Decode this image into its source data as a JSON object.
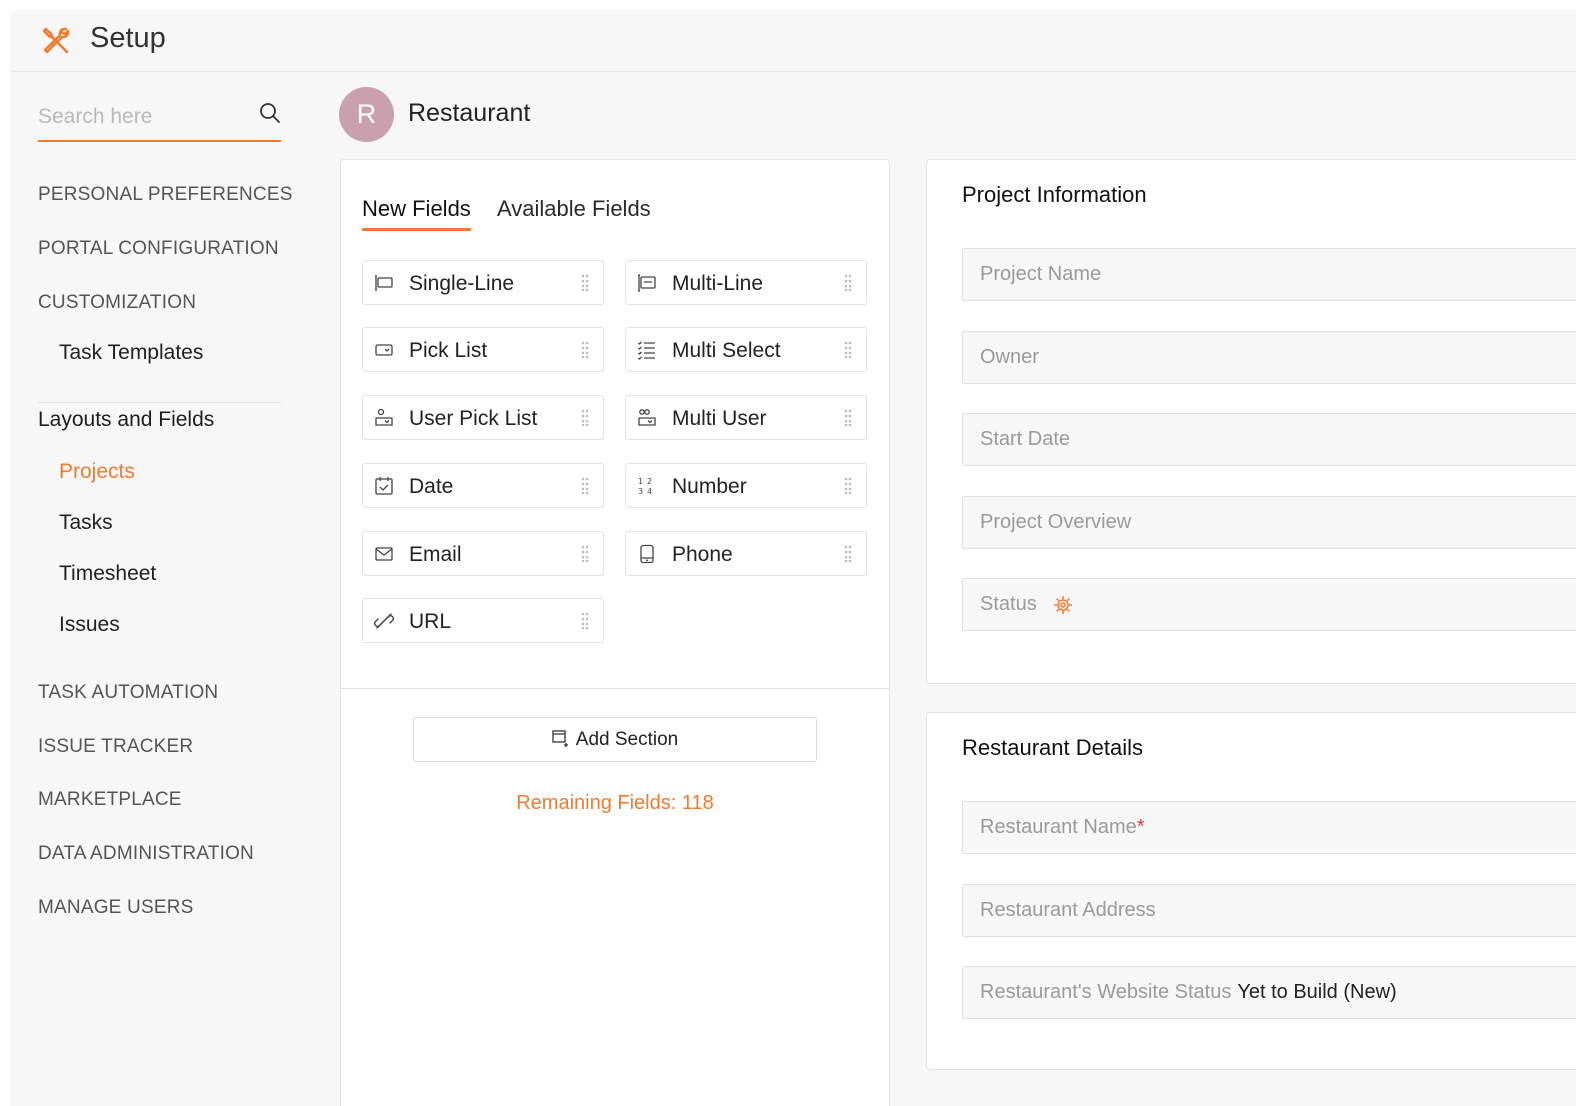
{
  "header": {
    "title": "Setup"
  },
  "sidebar": {
    "search_placeholder": "Search here",
    "sections": {
      "personal_preferences": "PERSONAL PREFERENCES",
      "portal_configuration": "PORTAL CONFIGURATION",
      "customization": "CUSTOMIZATION",
      "task_automation": "TASK AUTOMATION",
      "issue_tracker": "ISSUE TRACKER",
      "marketplace": "MARKETPLACE",
      "data_administration": "DATA ADMINISTRATION",
      "manage_users": "MANAGE USERS"
    },
    "task_templates": "Task Templates",
    "layouts_group": "Layouts and Fields",
    "layout_items": [
      "Projects",
      "Tasks",
      "Timesheet",
      "Issues"
    ],
    "active_item": "Projects"
  },
  "layout": {
    "avatar_letter": "R",
    "name": "Restaurant"
  },
  "fields_panel": {
    "tabs": [
      "New Fields",
      "Available Fields"
    ],
    "active_tab": "New Fields",
    "fields": [
      {
        "label": "Single-Line",
        "icon": "single-line-icon"
      },
      {
        "label": "Multi-Line",
        "icon": "multi-line-icon"
      },
      {
        "label": "Pick List",
        "icon": "pick-list-icon"
      },
      {
        "label": "Multi Select",
        "icon": "multi-select-icon"
      },
      {
        "label": "User Pick List",
        "icon": "user-pick-list-icon"
      },
      {
        "label": "Multi User",
        "icon": "multi-user-icon"
      },
      {
        "label": "Date",
        "icon": "calendar-icon"
      },
      {
        "label": "Number",
        "icon": "number-icon"
      },
      {
        "label": "Email",
        "icon": "email-icon"
      },
      {
        "label": "Phone",
        "icon": "phone-icon"
      },
      {
        "label": "URL",
        "icon": "link-icon"
      }
    ],
    "add_section_label": "Add Section",
    "remaining_fields": "Remaining Fields: 118"
  },
  "project_information": {
    "title": "Project Information",
    "fields": [
      "Project Name",
      "Owner",
      "Start Date",
      "Project Overview",
      "Status"
    ]
  },
  "restaurant_details": {
    "title": "Restaurant Details",
    "fields": [
      {
        "label": "Restaurant Name",
        "required_mark": "*"
      },
      {
        "label": "Restaurant Address"
      },
      {
        "label": "Restaurant's Website Status",
        "value": "Yet to Build (New)"
      }
    ]
  },
  "colors": {
    "accent": "#f27a2e",
    "avatar": "#c9a0ae",
    "required": "#e53935"
  }
}
